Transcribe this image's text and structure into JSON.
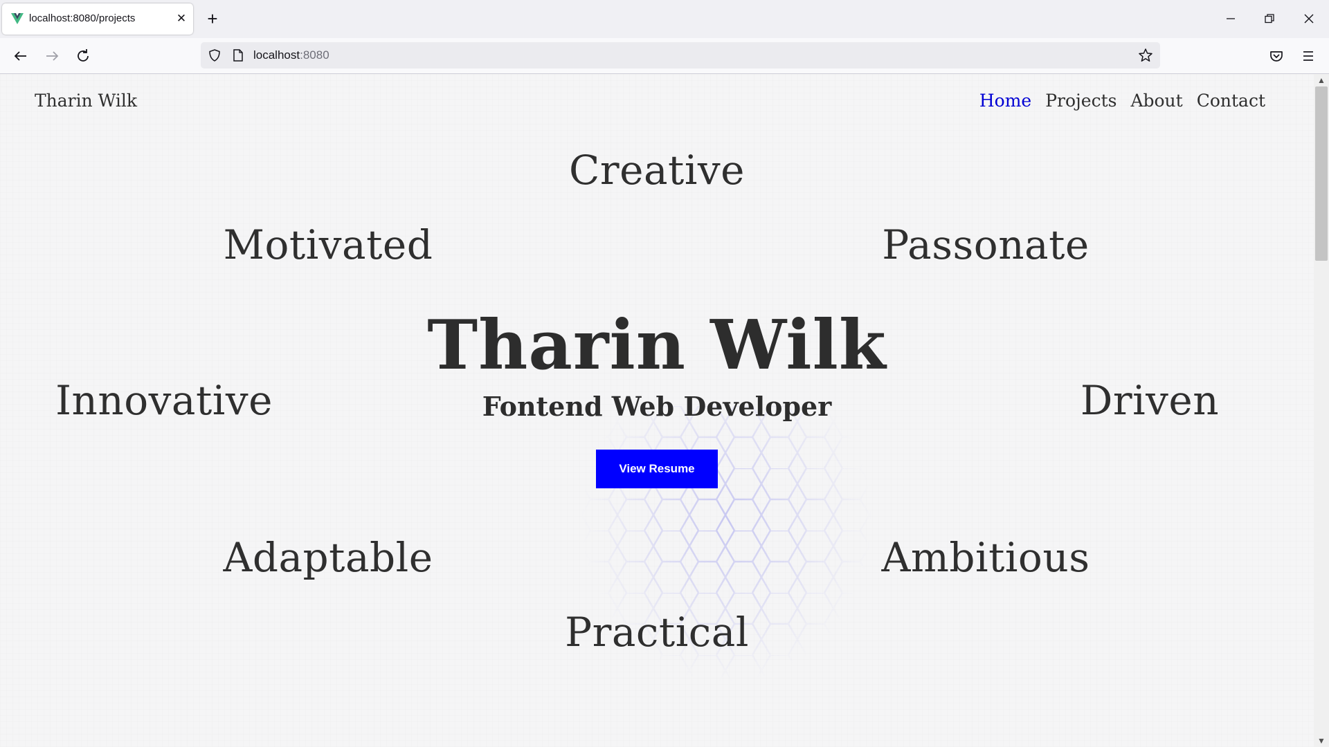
{
  "browser": {
    "tab_title": "localhost:8080/projects",
    "tab_close": "✕",
    "new_tab": "+",
    "url_host": "localhost",
    "url_port": ":8080"
  },
  "site": {
    "brand": "Tharin Wilk",
    "nav": [
      {
        "label": "Home",
        "active": true
      },
      {
        "label": "Projects",
        "active": false
      },
      {
        "label": "About",
        "active": false
      },
      {
        "label": "Contact",
        "active": false
      }
    ],
    "hero": {
      "name": "Tharin Wilk",
      "role": "Fontend Web Developer",
      "button_label": "View Resume"
    },
    "words": {
      "top": "Creative",
      "upper_left": "Motivated",
      "upper_right": "Passonate",
      "mid_left": "Innovative",
      "mid_right": "Driven",
      "lower_left": "Adaptable",
      "lower_right": "Ambitious",
      "bottom": "Practical"
    }
  },
  "colors": {
    "accent": "#0000ff",
    "active_nav": "#0000d4",
    "text": "#2f2f2f",
    "favicon": "#41b883"
  },
  "icons": {
    "favicon": "vue-logo-icon",
    "back": "arrow-left-icon",
    "forward": "arrow-right-icon",
    "reload": "reload-icon",
    "shield": "tracking-protection-shield-icon",
    "page": "page-icon",
    "bookmark": "star-icon",
    "pocket": "pocket-icon",
    "menu": "hamburger-menu-icon"
  }
}
